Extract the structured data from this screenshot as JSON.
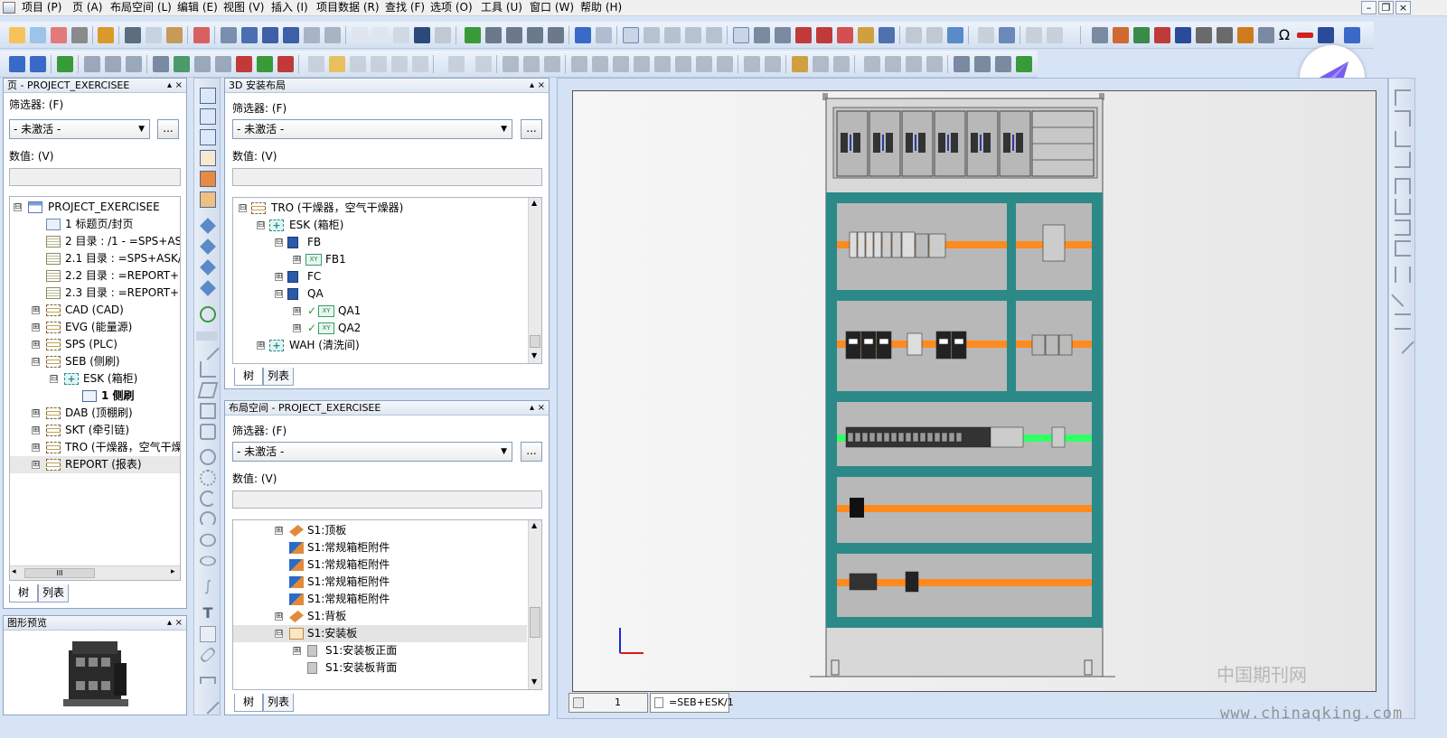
{
  "menubar": {
    "items": [
      "项目 (P)",
      "页 (A)",
      "布局空间 (L)",
      "编辑 (E)",
      "视图 (V)",
      "插入 (I)",
      "项目数据 (R)",
      "查找 (F)",
      "选项 (O)",
      "工具 (U)",
      "窗口 (W)",
      "帮助 (H)"
    ],
    "win_min": "–",
    "win_restore": "❐",
    "win_close": "×"
  },
  "pages_panel": {
    "title": "页 - PROJECT_EXERCISEE",
    "filter_label": "筛选器: (F)",
    "filter_value": "- 未激活 -",
    "browse_label": "...",
    "value_label": "数值: (V)",
    "nodes": [
      {
        "label": "PROJECT_EXERCISEE",
        "icon": "project-icon",
        "exp": "⊟"
      },
      {
        "label": "1 标题页/封页",
        "icon": "title-page-icon",
        "exp": ""
      },
      {
        "label": "2 目录 : /1 - =SPS+AS",
        "icon": "toc-page-icon",
        "exp": ""
      },
      {
        "label": "2.1 目录 : =SPS+ASK/S",
        "icon": "toc-page-icon",
        "exp": ""
      },
      {
        "label": "2.2 目录 : =REPORT+K",
        "icon": "toc-page-icon",
        "exp": ""
      },
      {
        "label": "2.3 目录 : =REPORT+E",
        "icon": "toc-page-icon",
        "exp": ""
      },
      {
        "label": "CAD (CAD)",
        "icon": "structure-icon",
        "exp": "⊞"
      },
      {
        "label": "EVG (能量源)",
        "icon": "structure-icon",
        "exp": "⊞"
      },
      {
        "label": "SPS (PLC)",
        "icon": "structure-icon",
        "exp": "⊞"
      },
      {
        "label": "SEB (侧刷)",
        "icon": "structure-icon",
        "exp": "⊟"
      },
      {
        "label": "ESK (箱柜)",
        "icon": "location-icon",
        "exp": "⊟"
      },
      {
        "label": "1 侧刷",
        "icon": "layout-page-icon",
        "exp": ""
      },
      {
        "label": "DAB (顶棚刷)",
        "icon": "structure-icon",
        "exp": "⊞"
      },
      {
        "label": "SKT (牵引链)",
        "icon": "structure-icon",
        "exp": "⊞"
      },
      {
        "label": "TRO (干燥器，空气干燥",
        "icon": "structure-icon",
        "exp": "⊞"
      },
      {
        "label": "REPORT (报表)",
        "icon": "structure-icon",
        "exp": "⊞"
      }
    ],
    "hscroll_thumb": "III",
    "tab_tree": "树",
    "tab_list": "列表"
  },
  "preview_panel": {
    "title": "图形预览"
  },
  "layout3d_panel": {
    "title": "3D 安装布局",
    "filter_label": "筛选器: (F)",
    "filter_value": "- 未激活 -",
    "browse_label": "...",
    "value_label": "数值: (V)",
    "nodes": [
      {
        "label": "TRO (干燥器，空气干燥器)",
        "exp": "⊟"
      },
      {
        "label": "ESK (箱柜)",
        "exp": "⊟"
      },
      {
        "label": "FB",
        "exp": "⊟"
      },
      {
        "label": "FB1",
        "exp": "⊞"
      },
      {
        "label": "FC",
        "exp": "⊞"
      },
      {
        "label": "QA",
        "exp": "⊟"
      },
      {
        "label": "QA1",
        "exp": "⊞"
      },
      {
        "label": "QA2",
        "exp": "⊞"
      },
      {
        "label": "WAH (清洗间)",
        "exp": "⊞"
      }
    ],
    "tab_tree": "树",
    "tab_list": "列表"
  },
  "layoutspace_panel": {
    "title": "布局空间 - PROJECT_EXERCISEE",
    "filter_label": "筛选器: (F)",
    "filter_value": "- 未激活 -",
    "browse_label": "...",
    "value_label": "数值: (V)",
    "nodes": [
      {
        "label": "S1:顶板",
        "exp": "⊞"
      },
      {
        "label": "S1:常规箱柜附件",
        "exp": ""
      },
      {
        "label": "S1:常规箱柜附件",
        "exp": ""
      },
      {
        "label": "S1:常规箱柜附件",
        "exp": ""
      },
      {
        "label": "S1:常规箱柜附件",
        "exp": ""
      },
      {
        "label": "S1:背板",
        "exp": "⊞"
      },
      {
        "label": "S1:安装板",
        "exp": "⊟"
      },
      {
        "label": "S1:安装板正面",
        "exp": "⊞"
      },
      {
        "label": "S1:安装板背面",
        "exp": ""
      }
    ],
    "tab_tree": "树",
    "tab_list": "列表"
  },
  "view_tabs": {
    "page_number": "1",
    "page_name": "=SEB+ESK/1"
  },
  "colors": {
    "rail_orange": "#ff8a1e",
    "rail_green": "#33ff66",
    "cabinet_frame": "#2b8a87",
    "mounting_plate": "#b8b8b8"
  },
  "watermark": {
    "line1": "中国期刊网",
    "line2": "www.chinaqking.com"
  }
}
